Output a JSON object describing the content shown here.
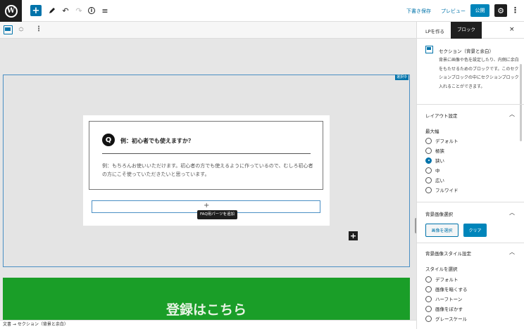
{
  "topbar": {
    "logo": "W",
    "add_icon": "+",
    "edit_icon": "pencil-icon",
    "undo_icon": "↶",
    "redo_icon": "↷",
    "info_icon": "i",
    "list_icon": "≡",
    "save_draft": "下書き保存",
    "preview": "プレビュー",
    "publish": "公開",
    "settings_icon": "⚙",
    "more_icon": "⋮"
  },
  "block_toolbar": {
    "mover_up": "︿",
    "mover_down": "﹀",
    "more_icon": "⋮"
  },
  "canvas": {
    "selected_tag": "選択中",
    "faq": {
      "q_mark": "Q",
      "question": "例：初心者でも使えますか？",
      "answer": "例：もちろんお使いいただけます。初心者の方でも使えるように作っているので、むしろ初心者の方にこそ使っていただきたいと思っています。"
    },
    "appender_plus": "+",
    "tooltip": "FAQ用パーツを追加",
    "inserter_plus": "+",
    "green_heading": "登録はこちら"
  },
  "footer": {
    "breadcrumb": "文書 → セクション（背景と余白）"
  },
  "sidebar": {
    "tab_document": "LPを作る",
    "tab_block": "ブロック",
    "close": "×",
    "block_title": "セクション（背景と余白）",
    "block_desc": "背景に画像や色を設定したり、内側に余白をもたせるためのブロックです。このセクションブロックの中にセクションブロック入れることができます。",
    "layout": {
      "heading": "レイアウト設定",
      "width_label": "最大幅",
      "options": [
        {
          "label": "デフォルト",
          "checked": false
        },
        {
          "label": "極狭",
          "checked": false
        },
        {
          "label": "狭い",
          "checked": true
        },
        {
          "label": "中",
          "checked": false
        },
        {
          "label": "広い",
          "checked": false
        },
        {
          "label": "フルワイド",
          "checked": false
        }
      ]
    },
    "bg_image": {
      "heading": "背景画像選択",
      "select_button": "画像を選択",
      "clear_button": "クリア"
    },
    "bg_style": {
      "heading": "背景画像スタイル設定",
      "style_label": "スタイルを選択",
      "options": [
        {
          "label": "デフォルト",
          "checked": false
        },
        {
          "label": "画像を暗くする",
          "checked": false
        },
        {
          "label": "ハーフトーン",
          "checked": false
        },
        {
          "label": "画像をぼかす",
          "checked": false
        },
        {
          "label": "グレースケール",
          "checked": false
        }
      ]
    },
    "caret_up": "︿"
  }
}
